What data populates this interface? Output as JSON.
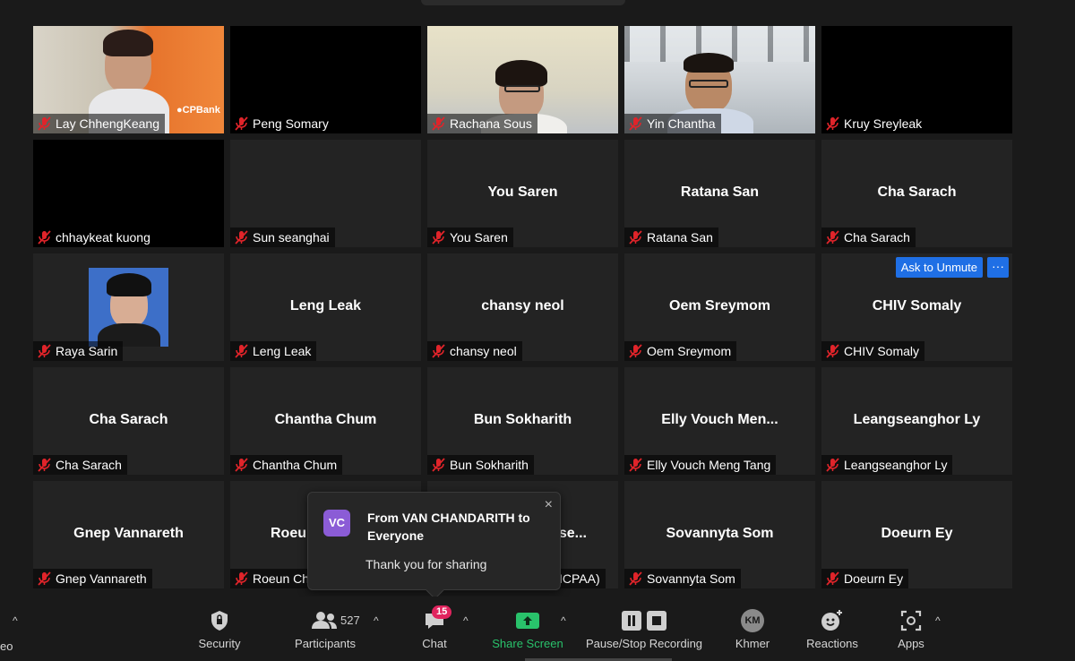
{
  "tiles": [
    {
      "tag": "Lay ChhengKeang"
    },
    {
      "tag": "Peng Somary"
    },
    {
      "tag": "Rachana Sous"
    },
    {
      "tag": "Yin Chantha"
    },
    {
      "tag": "Kruy Sreyleak"
    },
    {
      "tag": "chhaykeat kuong"
    },
    {
      "tag": "Sun seanghai"
    },
    {
      "center": "You Saren",
      "tag": "You Saren"
    },
    {
      "center": "Ratana San",
      "tag": "Ratana San"
    },
    {
      "center": "Cha Sarach",
      "tag": "Cha Sarach"
    },
    {
      "tag": "Raya Sarin"
    },
    {
      "center": "Leng Leak",
      "tag": "Leng Leak"
    },
    {
      "center": "chansy neol",
      "tag": "chansy neol"
    },
    {
      "center": "Oem Sreymom",
      "tag": "Oem Sreymom"
    },
    {
      "center": "CHIV Somaly",
      "tag": "CHIV Somaly"
    },
    {
      "center": "Cha Sarach",
      "tag": "Cha Sarach"
    },
    {
      "center": "Chantha Chum",
      "tag": "Chantha Chum"
    },
    {
      "center": "Bun Sokharith",
      "tag": "Bun Sokharith"
    },
    {
      "center": "Elly  Vouch  Men...",
      "tag": "Elly Vouch Meng Tang"
    },
    {
      "center": "Leangseanghor Ly",
      "tag": "Leangseanghor Ly"
    },
    {
      "center": "Gnep Vannareth",
      "tag": "Gnep Vannareth"
    },
    {
      "center": "Roeu",
      "tag": "Roeun Ch"
    },
    {
      "center": "se...",
      "tag": "ICPAA)"
    },
    {
      "center": "Sovannyta Som",
      "tag": "Sovannyta Som"
    },
    {
      "center": "Doeurn Ey",
      "tag": "Doeurn Ey"
    }
  ],
  "ask_unmute": "Ask to Unmute",
  "more": "···",
  "toast": {
    "avatar": "VC",
    "from": "From VAN CHANDARITH to Everyone",
    "message": "Thank you for sharing",
    "close": "×"
  },
  "toolbar": {
    "left_cut": "eo",
    "security": "Security",
    "participants": "Participants",
    "participant_count": "527",
    "chat": "Chat",
    "chat_badge": "15",
    "share": "Share Screen",
    "recording": "Pause/Stop Recording",
    "km": "KM",
    "khmer": "Khmer",
    "reactions": "Reactions",
    "apps": "Apps",
    "caret": "^"
  },
  "colors": {
    "accent_blue": "#1f6fe5",
    "share_green": "#29c26b",
    "badge_red": "#e0245e",
    "avatar_purple": "#8b5cd6",
    "muted_red": "#e0242a"
  }
}
